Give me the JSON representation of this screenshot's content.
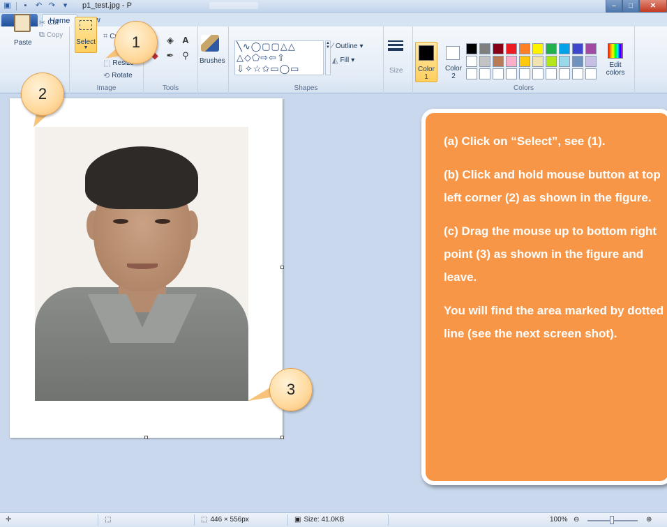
{
  "titlebar": {
    "file_title": "p1_test.jpg - P",
    "qat_icons": [
      "paint-app-icon",
      "save-icon",
      "undo-icon",
      "redo-icon",
      "customize-qat-icon"
    ]
  },
  "ribbon": {
    "file_tab": "▤ ▾",
    "tabs": [
      "Home",
      "View"
    ],
    "clipboard": {
      "paste": "Paste",
      "cut": "Cut",
      "copy": "Copy",
      "label": ""
    },
    "image": {
      "select": "Select",
      "crop": "Crop",
      "resize": "Resize",
      "rotate": "Rotate",
      "label": "Image"
    },
    "tools": {
      "label": "Tools"
    },
    "brushes": {
      "label": "Brushes"
    },
    "shapes": {
      "outline": "Outline",
      "fill": "Fill",
      "label": "Shapes",
      "rows": [
        "╲∿◯▢▢△△",
        "△◇⬠⇨⇦⇧",
        "⇩✧☆✩▭◯▭"
      ]
    },
    "size": {
      "label": "Size"
    },
    "colors": {
      "color1": "Color",
      "color1_num": "1",
      "color2": "Color",
      "color2_num": "2",
      "edit": "Edit colors",
      "label": "Colors",
      "palette": [
        "#000000",
        "#7f7f7f",
        "#880015",
        "#ed1c24",
        "#ff7f27",
        "#fff200",
        "#22b14c",
        "#00a2e8",
        "#3f48cc",
        "#a349a4",
        "#ffffff",
        "#c3c3c3",
        "#b97a57",
        "#ffaec9",
        "#ffc90e",
        "#efe4b0",
        "#b5e61d",
        "#99d9ea",
        "#7092be",
        "#c8bfe7",
        "#ffffff",
        "#ffffff",
        "#ffffff",
        "#ffffff",
        "#ffffff",
        "#ffffff",
        "#ffffff",
        "#ffffff",
        "#ffffff",
        "#ffffff"
      ]
    }
  },
  "callouts": {
    "one": "1",
    "two": "2",
    "three": "3"
  },
  "instructions": {
    "a": "(a) Click on “Select”, see (1).",
    "b": "(b) Click and hold mouse button at top left corner (2) as shown in the figure.",
    "c": "(c) Drag the mouse up to bottom right point (3) as shown in the figure and leave.",
    "d": "You will find the area marked by dotted line (see the next screen shot)."
  },
  "status": {
    "dimensions": "446 × 556px",
    "size": "Size: 41.0KB",
    "zoom": "100%"
  }
}
